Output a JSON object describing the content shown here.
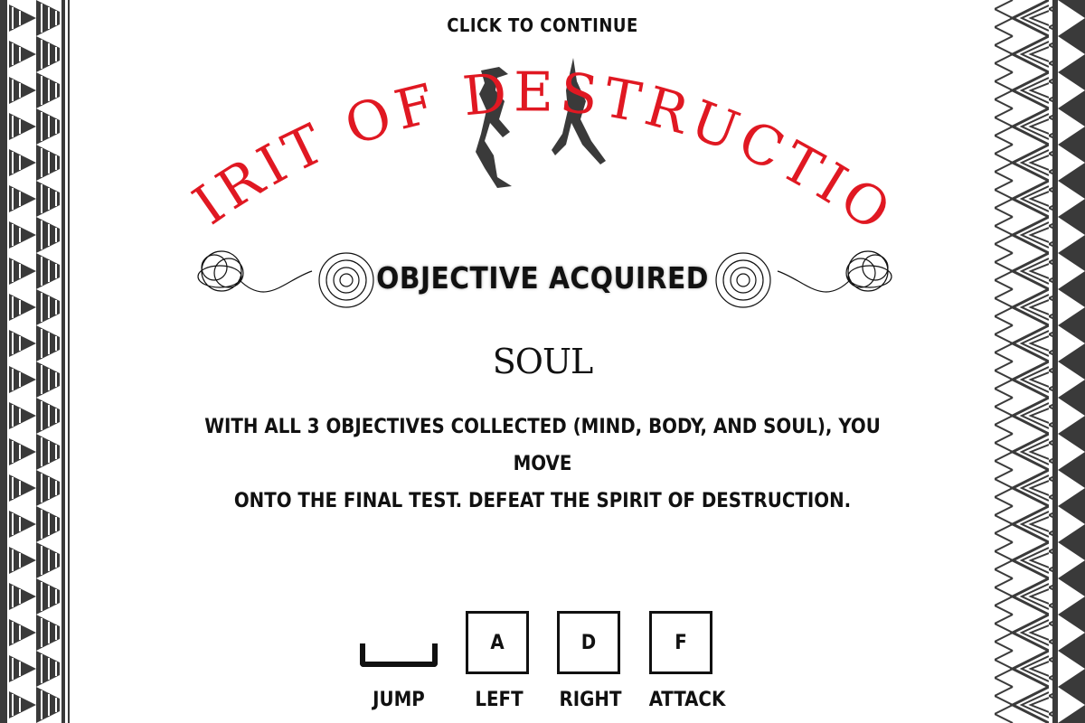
{
  "prompt": "CLICK TO CONTINUE",
  "game_title": "SPIRIT OF DESTRUCTION",
  "colors": {
    "title": "#e01822",
    "text": "#111111",
    "border_dark": "#3a3a3a",
    "background": "#ffffff"
  },
  "objective": {
    "heading": "OBJECTIVE ACQUIRED",
    "name": "SOUL",
    "description_line1": "WITH ALL 3 OBJECTIVES COLLECTED (MIND, BODY, AND SOUL), YOU MOVE",
    "description_line2": "ONTO THE FINAL TEST. DEFEAT THE SPIRIT OF DESTRUCTION."
  },
  "controls": [
    {
      "key": "",
      "label": "JUMP",
      "icon": "spacebar-icon"
    },
    {
      "key": "A",
      "label": "LEFT"
    },
    {
      "key": "D",
      "label": "RIGHT"
    },
    {
      "key": "F",
      "label": "ATTACK"
    }
  ],
  "decor": {
    "title_figure": "spirit-figure-icon",
    "ornaments": "swirl-ornament-icon",
    "borders": "tribal-pattern-border"
  }
}
